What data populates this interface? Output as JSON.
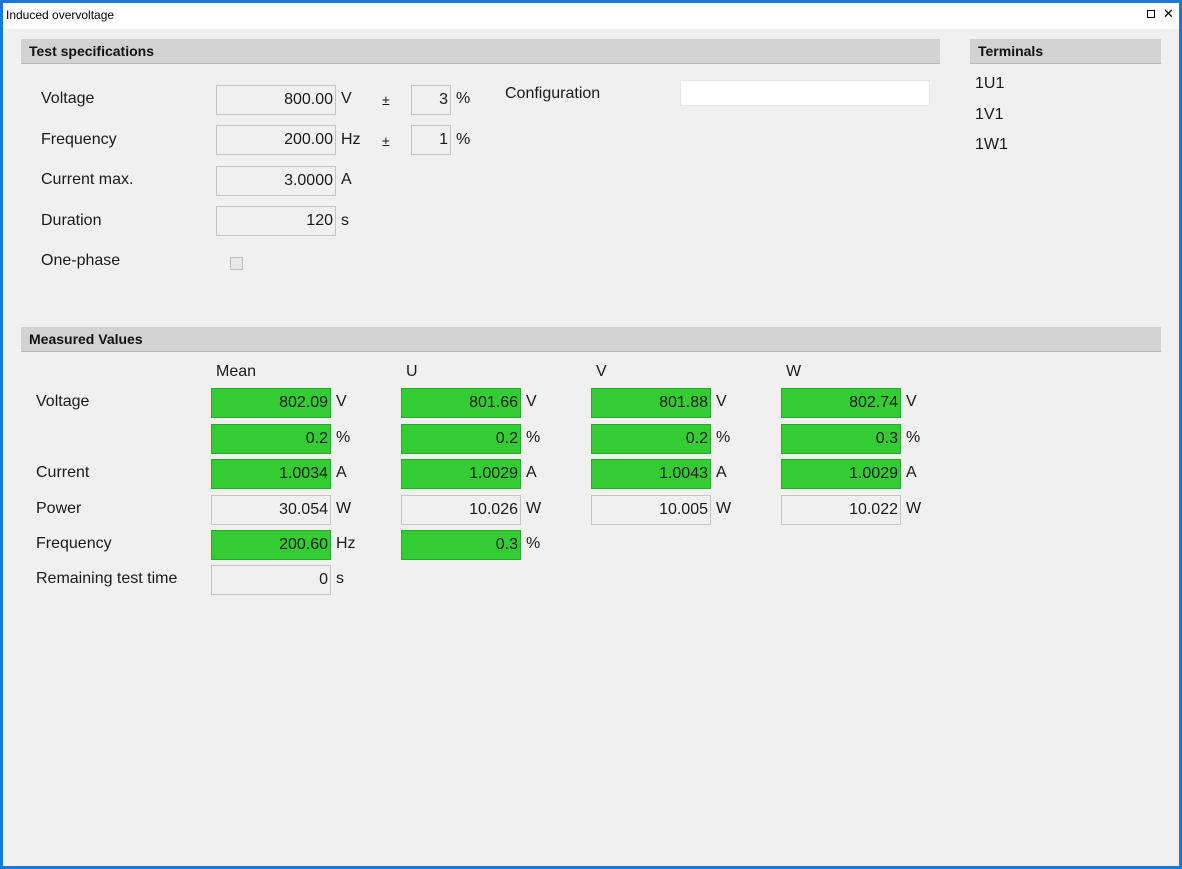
{
  "window": {
    "title": "Induced overvoltage"
  },
  "test_specifications": {
    "header": "Test specifications",
    "voltage": {
      "label": "Voltage",
      "value": "800.00",
      "unit": "V",
      "pm": "±",
      "tolerance": "3",
      "tol_unit": "%"
    },
    "frequency": {
      "label": "Frequency",
      "value": "200.00",
      "unit": "Hz",
      "pm": "±",
      "tolerance": "1",
      "tol_unit": "%"
    },
    "current_max": {
      "label": "Current max.",
      "value": "3.0000",
      "unit": "A"
    },
    "duration": {
      "label": "Duration",
      "value": "120",
      "unit": "s"
    },
    "one_phase": {
      "label": "One-phase",
      "checked": false
    },
    "configuration": {
      "label": "Configuration",
      "value": ""
    }
  },
  "terminals": {
    "header": "Terminals",
    "items": [
      "1U1",
      "1V1",
      "1W1"
    ]
  },
  "measured_values": {
    "header": "Measured Values",
    "columns": [
      "Mean",
      "U",
      "V",
      "W"
    ],
    "voltage": {
      "label": "Voltage",
      "values": [
        "802.09",
        "801.66",
        "801.88",
        "802.74"
      ],
      "unit": "V"
    },
    "voltage_pct": {
      "values": [
        "0.2",
        "0.2",
        "0.2",
        "0.3"
      ],
      "unit": "%"
    },
    "current": {
      "label": "Current",
      "values": [
        "1.0034",
        "1.0029",
        "1.0043",
        "1.0029"
      ],
      "unit": "A"
    },
    "power": {
      "label": "Power",
      "values": [
        "30.054",
        "10.026",
        "10.005",
        "10.022"
      ],
      "unit": "W"
    },
    "frequency": {
      "label": "Frequency",
      "mean": "200.60",
      "mean_unit": "Hz",
      "deviation": "0.3",
      "deviation_unit": "%"
    },
    "remaining": {
      "label": "Remaining test time",
      "value": "0",
      "unit": "s"
    }
  },
  "colors": {
    "ok_green": "#33cc33",
    "window_border": "#1b78d4",
    "header_bg": "#d2d2d2"
  }
}
